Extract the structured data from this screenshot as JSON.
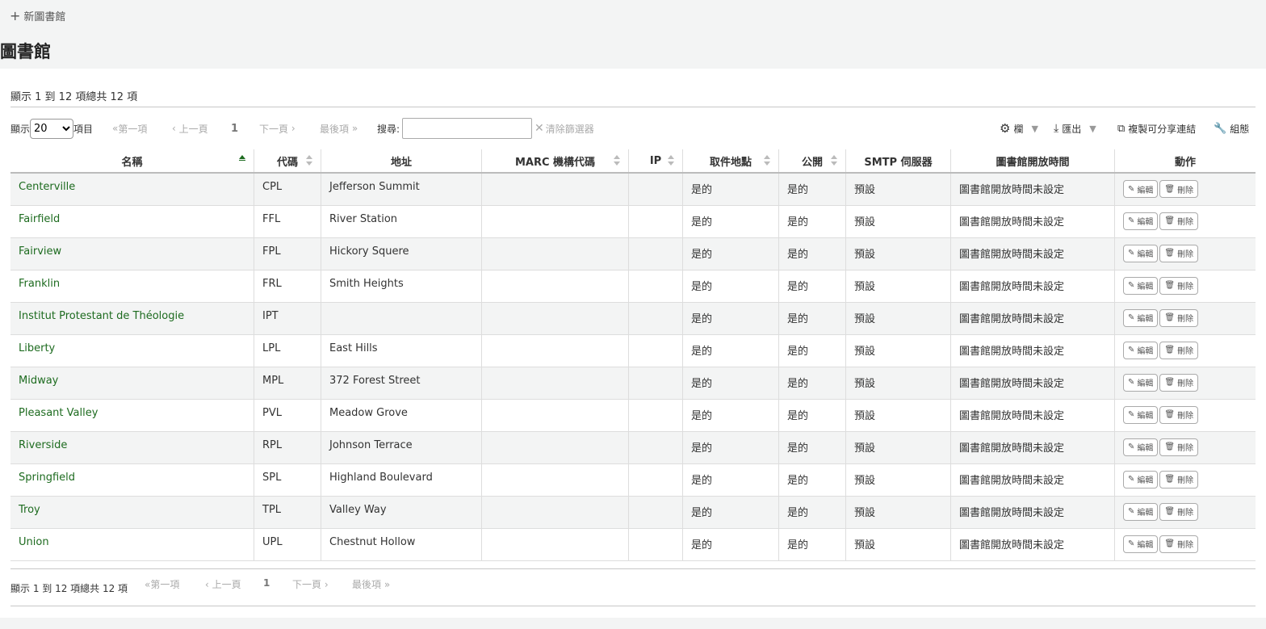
{
  "topbar": {
    "new_library": "新圖書館"
  },
  "title": "圖書館",
  "info": "顯示 1 到 12 項總共 12 項",
  "controls": {
    "show_label": "顯示",
    "length_value": "20",
    "items_label": "項目",
    "first": "第一項",
    "prev": "上一頁",
    "current_page": "1",
    "next": "下一頁",
    "last": "最後項",
    "search_label": "搜尋:",
    "search_value": "",
    "clear_filter": "清除篩選器",
    "columns": "欄",
    "export": "匯出",
    "copy_link": "複製可分享連結",
    "configure": "組態"
  },
  "table": {
    "headers": [
      "名稱",
      "代碼",
      "地址",
      "MARC 機構代碼",
      "IP",
      "取件地點",
      "公開",
      "SMTP 伺服器",
      "圖書館開放時間",
      "動作"
    ],
    "edit_label": "編輯",
    "delete_label": "刪除",
    "rows": [
      {
        "name": "Centerville",
        "code": "CPL",
        "address": "Jefferson Summit",
        "marc": "",
        "ip": "",
        "pickup": "是的",
        "public": "是的",
        "smtp": "預設",
        "hours": "圖書館開放時間未設定"
      },
      {
        "name": "Fairfield",
        "code": "FFL",
        "address": "River Station",
        "marc": "",
        "ip": "",
        "pickup": "是的",
        "public": "是的",
        "smtp": "預設",
        "hours": "圖書館開放時間未設定"
      },
      {
        "name": "Fairview",
        "code": "FPL",
        "address": "Hickory Squere",
        "marc": "",
        "ip": "",
        "pickup": "是的",
        "public": "是的",
        "smtp": "預設",
        "hours": "圖書館開放時間未設定"
      },
      {
        "name": "Franklin",
        "code": "FRL",
        "address": "Smith Heights",
        "marc": "",
        "ip": "",
        "pickup": "是的",
        "public": "是的",
        "smtp": "預設",
        "hours": "圖書館開放時間未設定"
      },
      {
        "name": "Institut Protestant de Théologie",
        "code": "IPT",
        "address": "",
        "marc": "",
        "ip": "",
        "pickup": "是的",
        "public": "是的",
        "smtp": "預設",
        "hours": "圖書館開放時間未設定"
      },
      {
        "name": "Liberty",
        "code": "LPL",
        "address": "East Hills",
        "marc": "",
        "ip": "",
        "pickup": "是的",
        "public": "是的",
        "smtp": "預設",
        "hours": "圖書館開放時間未設定"
      },
      {
        "name": "Midway",
        "code": "MPL",
        "address": "372 Forest Street",
        "marc": "",
        "ip": "",
        "pickup": "是的",
        "public": "是的",
        "smtp": "預設",
        "hours": "圖書館開放時間未設定"
      },
      {
        "name": "Pleasant Valley",
        "code": "PVL",
        "address": "Meadow Grove",
        "marc": "",
        "ip": "",
        "pickup": "是的",
        "public": "是的",
        "smtp": "預設",
        "hours": "圖書館開放時間未設定"
      },
      {
        "name": "Riverside",
        "code": "RPL",
        "address": "Johnson Terrace",
        "marc": "",
        "ip": "",
        "pickup": "是的",
        "public": "是的",
        "smtp": "預設",
        "hours": "圖書館開放時間未設定"
      },
      {
        "name": "Springfield",
        "code": "SPL",
        "address": "Highland Boulevard",
        "marc": "",
        "ip": "",
        "pickup": "是的",
        "public": "是的",
        "smtp": "預設",
        "hours": "圖書館開放時間未設定"
      },
      {
        "name": "Troy",
        "code": "TPL",
        "address": "Valley Way",
        "marc": "",
        "ip": "",
        "pickup": "是的",
        "public": "是的",
        "smtp": "預設",
        "hours": "圖書館開放時間未設定"
      },
      {
        "name": "Union",
        "code": "UPL",
        "address": "Chestnut Hollow",
        "marc": "",
        "ip": "",
        "pickup": "是的",
        "public": "是的",
        "smtp": "預設",
        "hours": "圖書館開放時間未設定"
      }
    ]
  }
}
